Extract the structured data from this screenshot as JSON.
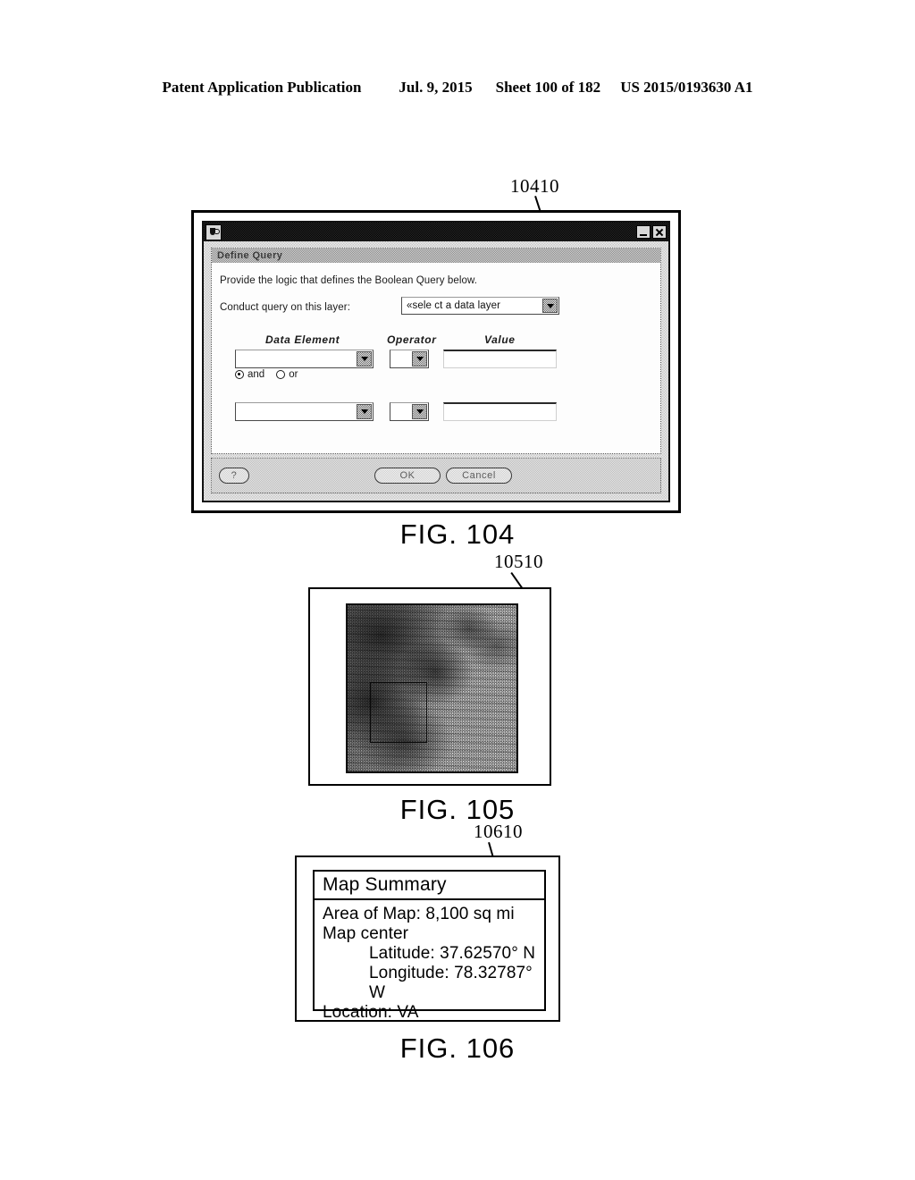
{
  "header": {
    "publication": "Patent Application Publication",
    "date": "Jul. 9, 2015",
    "sheet": "Sheet 100 of 182",
    "docnumber": "US 2015/0193630 A1"
  },
  "figures": {
    "fig104": {
      "caption": "FIG. 104",
      "reference_numeral": "10410",
      "window": {
        "app_icon": "coffee-cup-icon",
        "minimize_label": "_",
        "close_label": "X"
      },
      "panel": {
        "title": "Define Query",
        "intro_text": "Provide the logic that defines the Boolean Query below.",
        "layer_label": "Conduct query on this layer:",
        "layer_select_value": "«sele ct a data layer",
        "column_headers": {
          "data_element": "Data Element",
          "operator": "Operator",
          "value": "Value"
        },
        "row1": {
          "data_element_value": "",
          "operator_value": "",
          "value_value": ""
        },
        "row2": {
          "data_element_value": "",
          "operator_value": "",
          "value_value": ""
        },
        "logic": {
          "and_label": "and",
          "or_label": "or",
          "selected": "and"
        }
      },
      "buttons": {
        "help": "?",
        "ok": "OK",
        "cancel": "Cancel"
      }
    },
    "fig105": {
      "caption": "FIG. 105",
      "reference_numeral": "10510",
      "map_description": "dithered halftone terrain map with selection rectangle"
    },
    "fig106": {
      "caption": "FIG. 106",
      "reference_numeral": "10610",
      "title": "Map Summary",
      "lines": {
        "area": "Area of Map:  8,100 sq mi",
        "center": "Map center",
        "latitude": "Latitude:  37.62570° N",
        "longitude": "Longitude:  78.32787° W",
        "location": "Location:  VA"
      }
    }
  }
}
